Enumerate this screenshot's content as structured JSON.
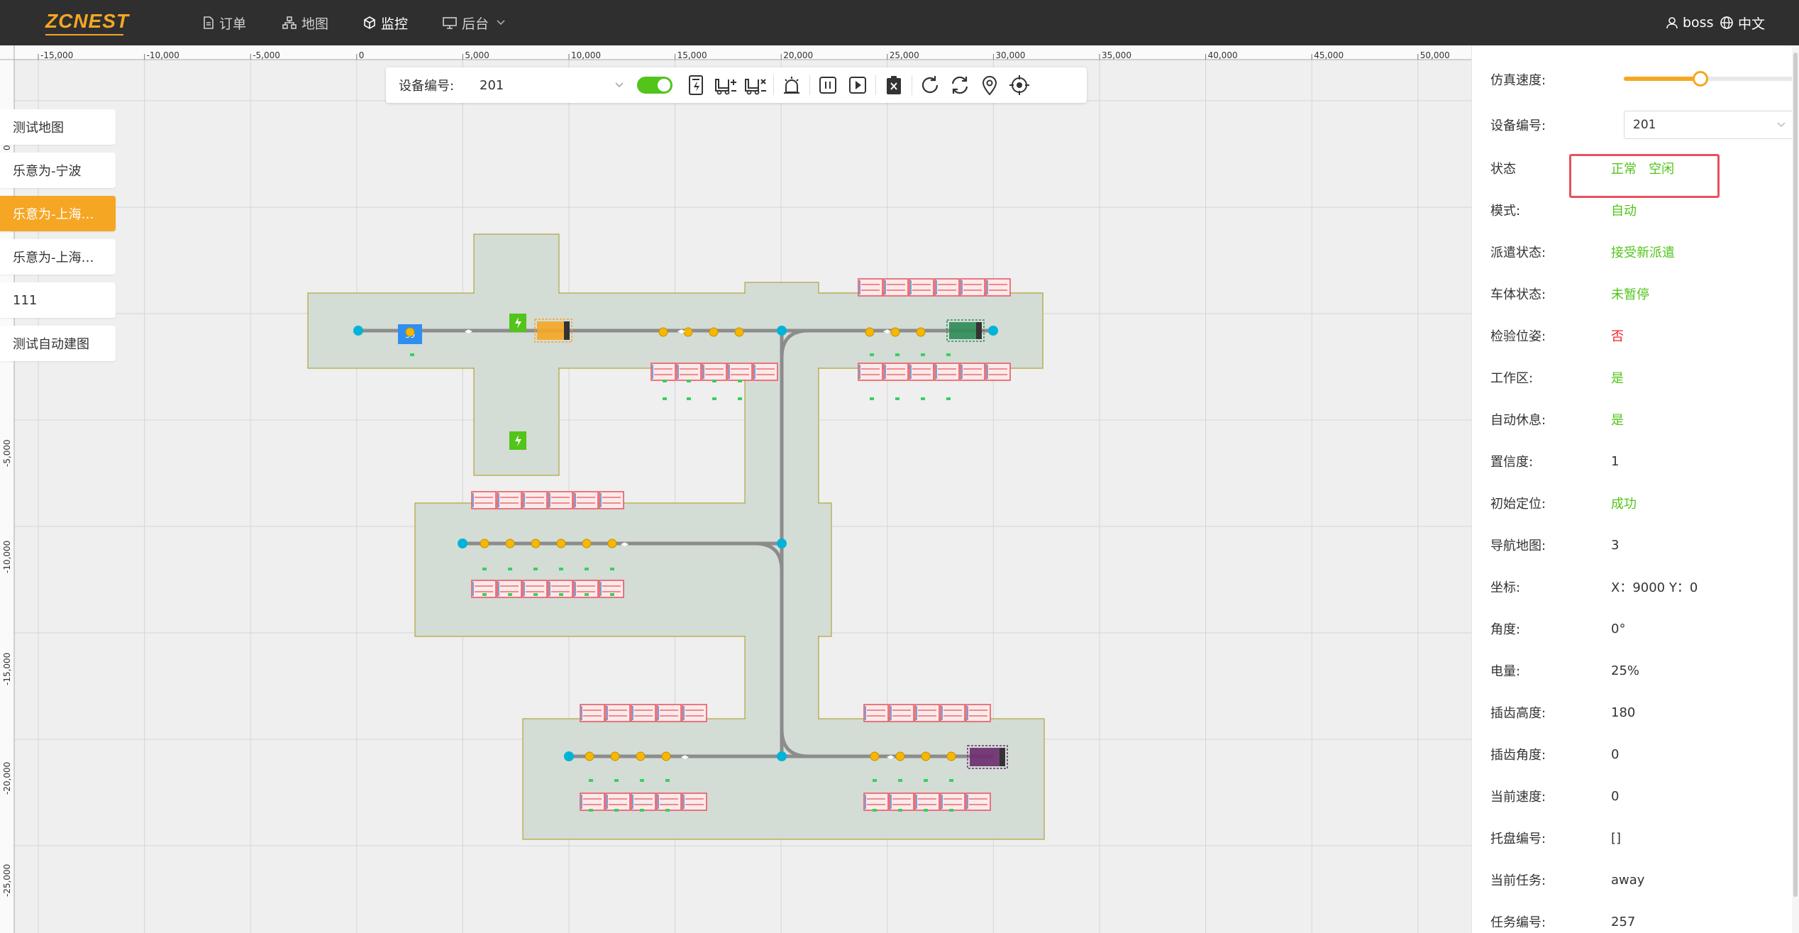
{
  "app": {
    "logo_text": "ZCNEST",
    "nav": [
      {
        "label": "订单",
        "icon": "document-icon"
      },
      {
        "label": "地图",
        "icon": "sitemap-icon"
      },
      {
        "label": "监控",
        "icon": "cube-icon",
        "active": true
      },
      {
        "label": "后台",
        "icon": "monitor-icon",
        "has_dropdown": true
      }
    ],
    "user": "boss",
    "language": "中文"
  },
  "colors": {
    "accent": "#f5a623",
    "topbar": "#2f2f2f",
    "ok": "#52c41a",
    "error": "#f5222d",
    "highlight_box": "#e8505b",
    "area": "#d4dcd6",
    "rack_red": "#e8505b",
    "node": "#00b4d8"
  },
  "map": {
    "x_ticks": [
      "-15,000",
      "-10,000",
      "-5,000",
      "0",
      "5,000",
      "10,000",
      "15,000",
      "20,000",
      "25,000",
      "30,000",
      "35,000",
      "40,000",
      "45,000",
      "50,000"
    ],
    "y_ticks": [
      "0",
      "-5,000",
      "-10,000",
      "-15,000",
      "-20,000",
      "-25,000"
    ],
    "station_badge": "39"
  },
  "sidebar": {
    "items": [
      {
        "label": "测试地图"
      },
      {
        "label": "乐意为-宁波"
      },
      {
        "label": "乐意为-上海一…",
        "active": true
      },
      {
        "label": "乐意为-上海二…"
      },
      {
        "label": "111"
      },
      {
        "label": "测试自动建图"
      }
    ]
  },
  "toolbar": {
    "device_label": "设备编号:",
    "device_value": "201",
    "auto_switch_on": true,
    "buttons": [
      "charge-icon",
      "forklift-add-icon",
      "forklift-remove-icon",
      "alarm-icon",
      "pause-icon",
      "play-icon",
      "clear-icon",
      "redo-icon",
      "sync-icon",
      "location-pin-icon",
      "target-icon"
    ]
  },
  "panel": {
    "speed_label": "仿真速度:",
    "speed_level": 0.44,
    "device_label": "设备编号:",
    "device_value": "201",
    "rows": [
      {
        "label": "状态",
        "value": "正常   空闲",
        "color": "green"
      },
      {
        "label": "模式:",
        "value": "自动",
        "color": "green"
      },
      {
        "label": "派遣状态:",
        "value": "接受新派遣",
        "color": "green"
      },
      {
        "label": "车体状态:",
        "value": "未暂停",
        "color": "green"
      },
      {
        "label": "检验位姿:",
        "value": "否",
        "color": "red"
      },
      {
        "label": "工作区:",
        "value": "是",
        "color": "green"
      },
      {
        "label": "自动休息:",
        "value": "是",
        "color": "green"
      },
      {
        "label": "置信度:",
        "value": "1",
        "color": ""
      },
      {
        "label": "初始定位:",
        "value": "成功",
        "color": "green"
      },
      {
        "label": "导航地图:",
        "value": "3",
        "color": ""
      },
      {
        "label": "坐标:",
        "value": "X：9000 Y：0",
        "color": ""
      },
      {
        "label": "角度:",
        "value": "0°",
        "color": ""
      },
      {
        "label": "电量:",
        "value": "25%",
        "color": ""
      },
      {
        "label": "插齿高度:",
        "value": "180",
        "color": ""
      },
      {
        "label": "插齿角度:",
        "value": "0",
        "color": ""
      },
      {
        "label": "当前速度:",
        "value": "0",
        "color": ""
      },
      {
        "label": "托盘编号:",
        "value": "[]",
        "color": ""
      },
      {
        "label": "当前任务:",
        "value": "away",
        "color": ""
      },
      {
        "label": "任务编号:",
        "value": "257",
        "color": ""
      }
    ]
  }
}
